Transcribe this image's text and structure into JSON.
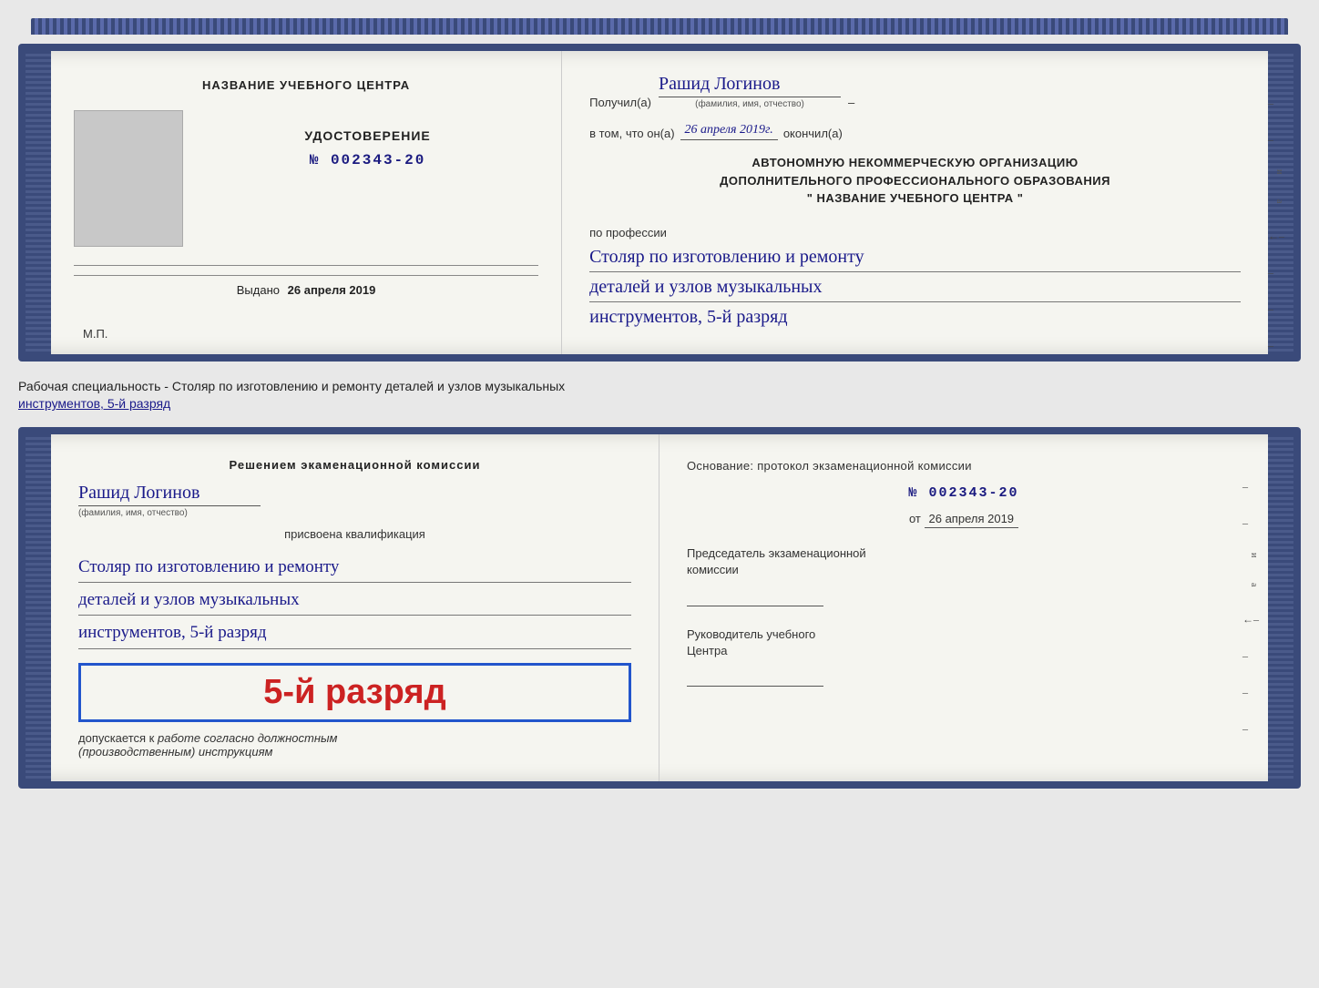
{
  "doc1": {
    "left": {
      "center_title": "НАЗВАНИЕ УЧЕБНОГО ЦЕНТРА",
      "cert_type_label": "УДОСТОВЕРЕНИЕ",
      "cert_number": "№ 002343-20",
      "issued_label": "Выдано",
      "issued_date": "26 апреля 2019",
      "mp_label": "М.П."
    },
    "right": {
      "recipient_prefix": "Получил(а)",
      "recipient_name": "Рашид Логинов",
      "recipient_sublabel": "(фамилия, имя, отчество)",
      "dash": "–",
      "completed_line": "в том, что он(а)",
      "completed_date": "26 апреля 2019г.",
      "completed_suffix": "окончил(а)",
      "org_line1": "АВТОНОМНУЮ НЕКОММЕРЧЕСКУЮ ОРГАНИЗАЦИЮ",
      "org_line2": "ДОПОЛНИТЕЛЬНОГО ПРОФЕССИОНАЛЬНОГО ОБРАЗОВАНИЯ",
      "org_line3": "\" НАЗВАНИЕ УЧЕБНОГО ЦЕНТРА \"",
      "profession_label": "по профессии",
      "profession_line1": "Столяр по изготовлению и ремонту",
      "profession_line2": "деталей и узлов музыкальных",
      "profession_line3": "инструментов, 5-й разряд"
    }
  },
  "between": {
    "text": "Рабочая специальность - Столяр по изготовлению и ремонту деталей и узлов музыкальных",
    "text2": "инструментов, 5-й разряд"
  },
  "doc2": {
    "left": {
      "decision_text": "Решением экаменационной комиссии",
      "person_name": "Рашид Логинов",
      "person_sublabel": "(фамилия, имя, отчество)",
      "qualification_label": "присвоена квалификация",
      "qual_line1": "Столяр по изготовлению и ремонту",
      "qual_line2": "деталей и узлов музыкальных",
      "qual_line3": "инструментов, 5-й разряд",
      "big_rank": "5-й разряд",
      "allowed_prefix": "допускается к",
      "allowed_text": "работе согласно должностным",
      "allowed_text2": "(производственным) инструкциям"
    },
    "right": {
      "basis_text": "Основание: протокол экзаменационной комиссии",
      "protocol_number": "№ 002343-20",
      "protocol_date_prefix": "от",
      "protocol_date": "26 апреля 2019",
      "chairman_label1": "Председатель экзаменационной",
      "chairman_label2": "комиссии",
      "director_label1": "Руководитель учебного",
      "director_label2": "Центра"
    }
  }
}
